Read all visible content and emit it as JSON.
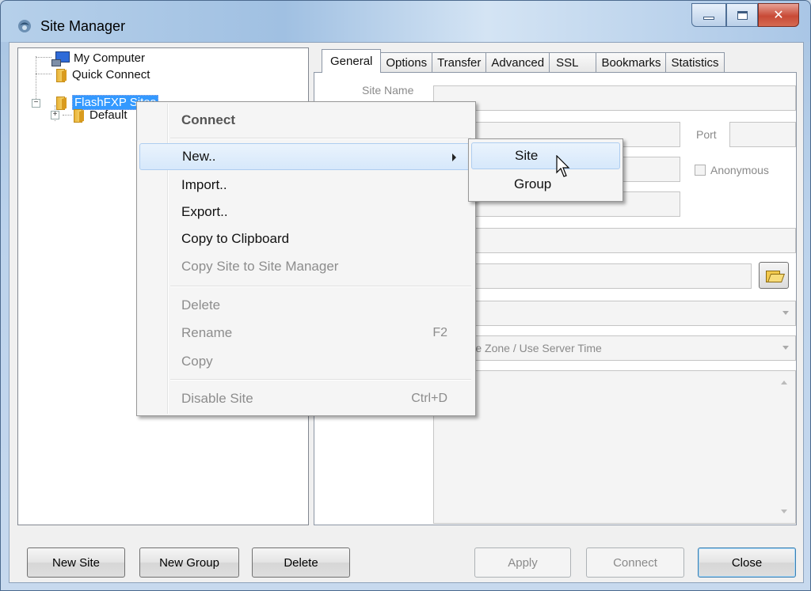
{
  "window": {
    "title": "Site Manager"
  },
  "tree": {
    "items": [
      {
        "label": "My Computer"
      },
      {
        "label": "Quick Connect"
      },
      {
        "label": "FlashFXP Sites"
      },
      {
        "label": "Default"
      }
    ]
  },
  "tabs": [
    {
      "label": "General"
    },
    {
      "label": "Options"
    },
    {
      "label": "Transfer"
    },
    {
      "label": "Advanced"
    },
    {
      "label": "SSL"
    },
    {
      "label": "Bookmarks"
    },
    {
      "label": "Statistics"
    }
  ],
  "general": {
    "site_name_label": "Site Name",
    "port_label": "Port",
    "anonymous_label": "Anonymous",
    "combo1_value": ")",
    "timezone_value": "wn Time Zone / Use Server Time"
  },
  "context_menu": {
    "connect": "Connect",
    "new": "New..",
    "import": "Import..",
    "export": "Export..",
    "copy_clipboard": "Copy to Clipboard",
    "copy_site": "Copy Site to Site Manager",
    "delete": "Delete",
    "rename": "Rename",
    "rename_shortcut": "F2",
    "copy": "Copy",
    "disable_site": "Disable Site",
    "disable_shortcut": "Ctrl+D"
  },
  "submenu": {
    "site": "Site",
    "group": "Group"
  },
  "buttons": {
    "new_site": "New Site",
    "new_group": "New Group",
    "delete": "Delete",
    "apply": "Apply",
    "connect": "Connect",
    "close": "Close"
  },
  "colors": {
    "selection": "#3399ff",
    "menu_highlight": "#d6e8fb"
  }
}
